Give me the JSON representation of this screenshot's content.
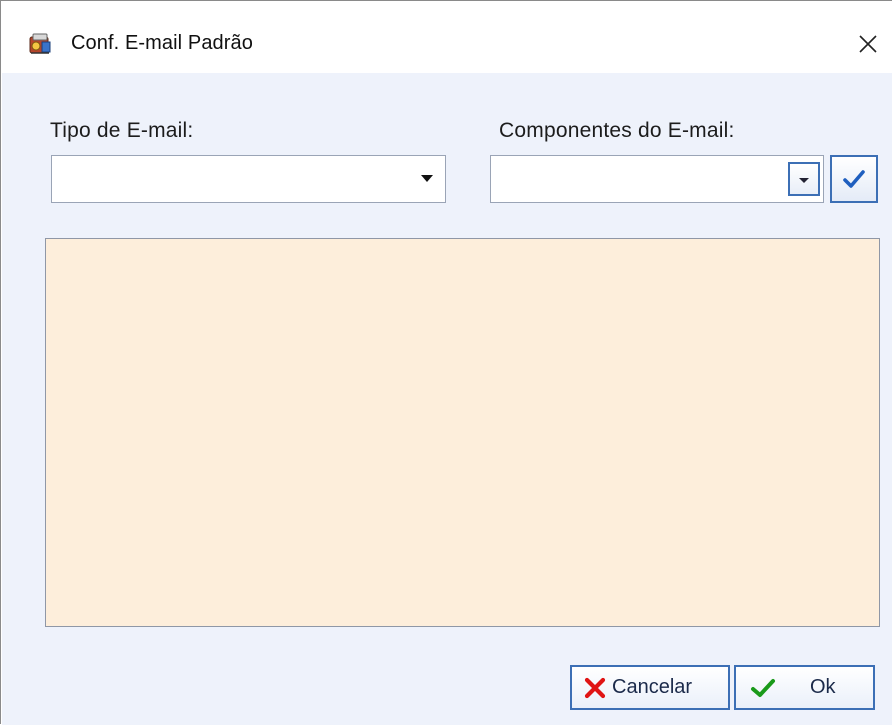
{
  "window": {
    "title": "Conf. E-mail Padrão",
    "icon": "app-icon",
    "close_icon": "close-icon"
  },
  "form": {
    "tipo_label": "Tipo de E-mail:",
    "tipo_value": "",
    "componentes_label": "Componentes do E-mail:",
    "componentes_value": "",
    "body_text": ""
  },
  "buttons": {
    "cancel_label": "Cancelar",
    "ok_label": "Ok"
  },
  "colors": {
    "client_bg": "#eef2fb",
    "textarea_bg": "#fdeedb",
    "button_border": "#3c6fb5",
    "cancel_icon": "#e01414",
    "ok_icon": "#1a9a1a",
    "confirm_icon": "#1f5fbf"
  }
}
